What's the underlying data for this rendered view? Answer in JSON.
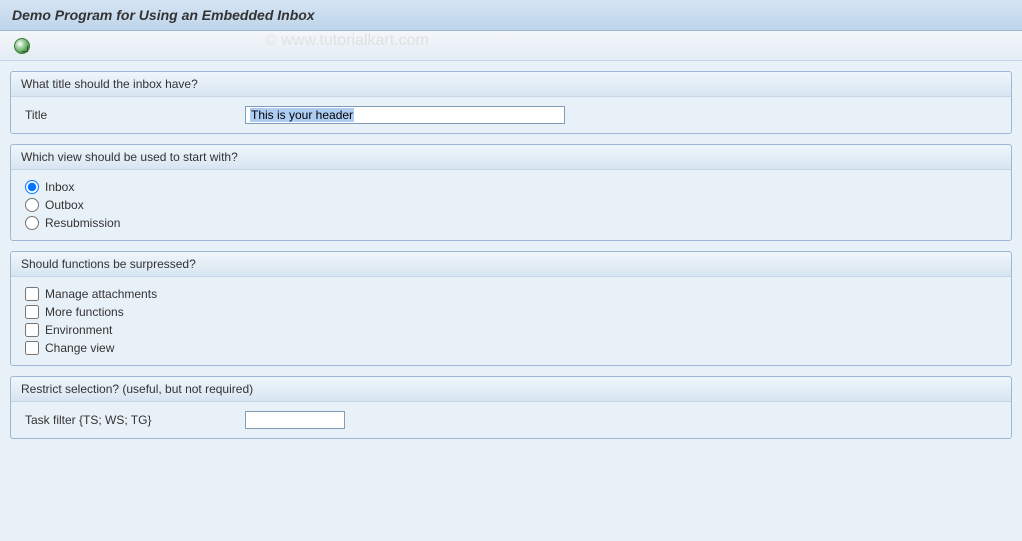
{
  "window_title": "Demo Program for Using an Embedded Inbox",
  "watermark": "© www.tutorialkart.com",
  "groups": {
    "title": {
      "legend": "What title should the inbox have?",
      "field_label": "Title",
      "field_value": "This is your header"
    },
    "view": {
      "legend": "Which view should be used to start with?",
      "options": {
        "inbox": "Inbox",
        "outbox": "Outbox",
        "resubmission": "Resubmission"
      }
    },
    "suppress": {
      "legend": "Should functions be surpressed?",
      "options": {
        "attachments": "Manage attachments",
        "more": "More functions",
        "environment": "Environment",
        "changeview": "Change view"
      }
    },
    "restrict": {
      "legend": "Restrict selection? (useful, but not required)",
      "task_label": "Task filter {TS; WS; TG}",
      "task_value": ""
    }
  }
}
